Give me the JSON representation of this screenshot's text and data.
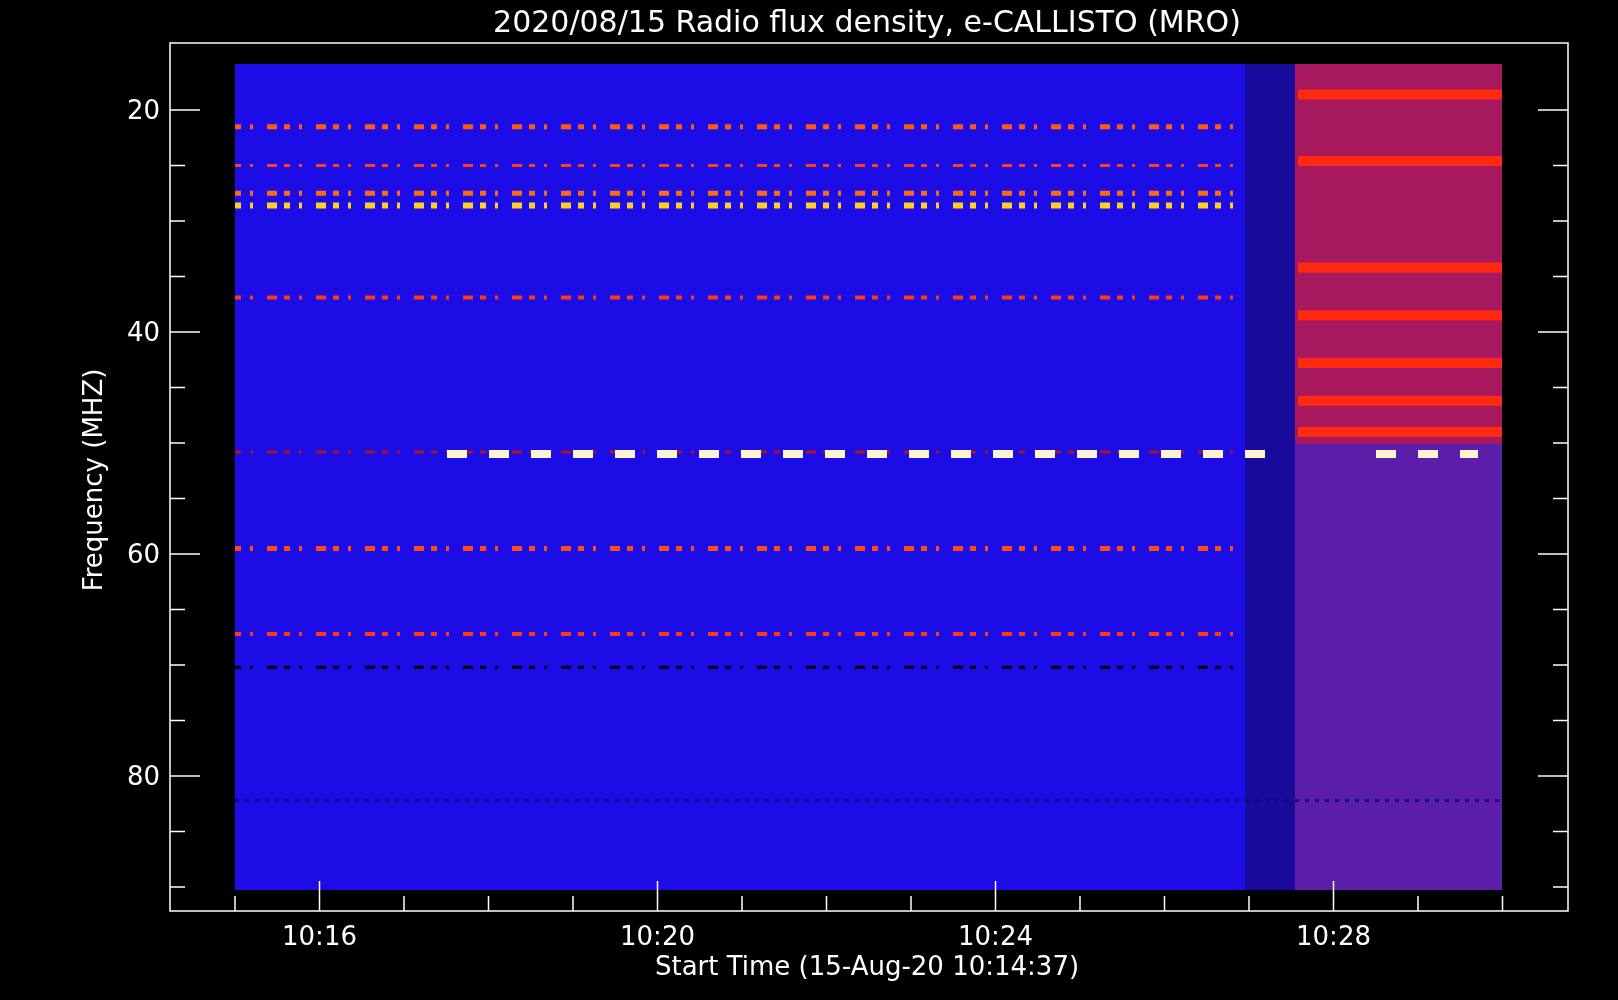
{
  "title": "2020/08/15  Radio flux density, e-CALLISTO (MRO)",
  "ylabel": "Frequency (MHZ)",
  "xlabel": "Start Time (15-Aug-20 10:14:37)",
  "y_ticks": [
    "20",
    "40",
    "60",
    "80"
  ],
  "x_ticks": [
    "10:16",
    "10:20",
    "10:24",
    "10:28"
  ]
}
